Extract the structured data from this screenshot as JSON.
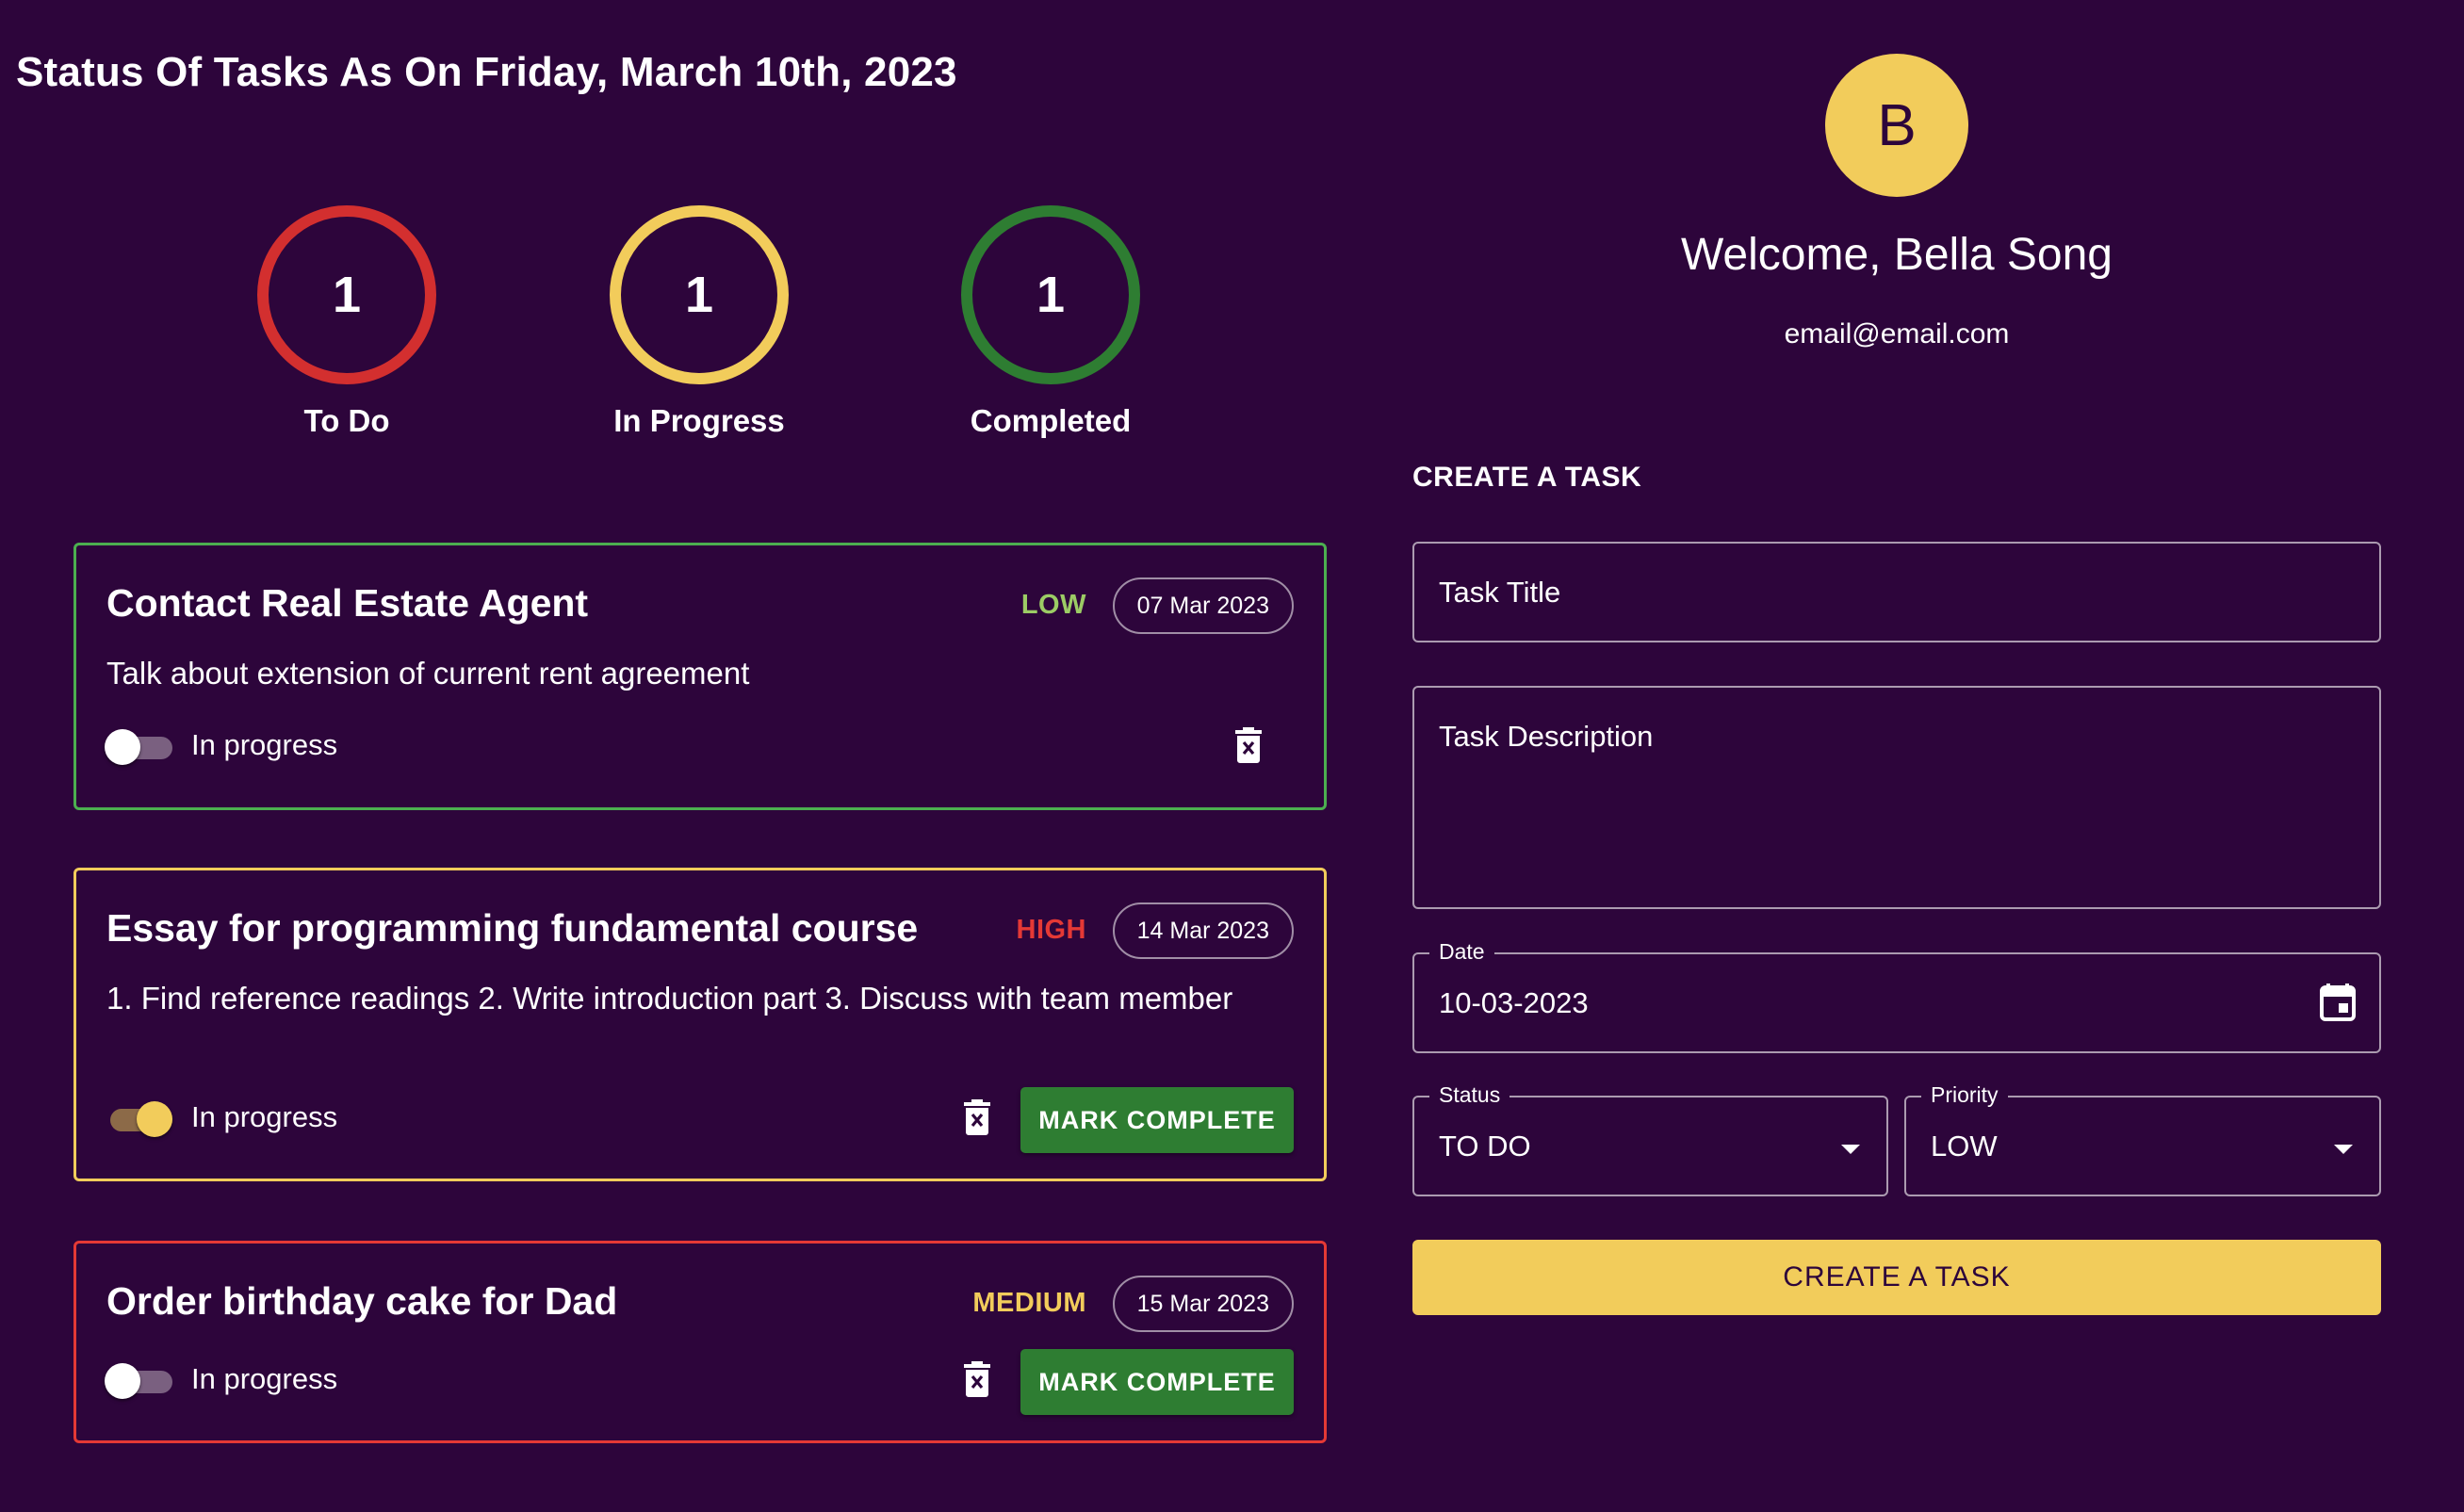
{
  "header": {
    "title": "Status Of Tasks As On Friday, March 10th, 2023"
  },
  "stats": [
    {
      "count": "1",
      "label": "To Do",
      "color": "#d32f2f"
    },
    {
      "count": "1",
      "label": "In Progress",
      "color": "#f2cc5b"
    },
    {
      "count": "1",
      "label": "Completed",
      "color": "#2e7d32"
    }
  ],
  "tasks": [
    {
      "title": "Contact Real Estate Agent",
      "description": "Talk about extension of current rent agreement",
      "priority": "LOW",
      "priority_color": "#9ccc65",
      "date": "07 Mar 2023",
      "toggle_label": "In progress",
      "toggle_on": false,
      "border_color": "#4caf50",
      "has_mark_complete": false
    },
    {
      "title": "Essay for programming fundamental course",
      "description": "1. Find reference readings 2. Write introduction part 3. Discuss with team member",
      "priority": "HIGH",
      "priority_color": "#e53935",
      "date": "14 Mar 2023",
      "toggle_label": "In progress",
      "toggle_on": true,
      "border_color": "#f2cc5b",
      "has_mark_complete": true,
      "mark_complete_label": "MARK COMPLETE"
    },
    {
      "title": "Order birthday cake for Dad",
      "description": "",
      "priority": "MEDIUM",
      "priority_color": "#f2cc5b",
      "date": "15 Mar 2023",
      "toggle_label": "In progress",
      "toggle_on": false,
      "border_color": "#e53935",
      "has_mark_complete": true,
      "mark_complete_label": "MARK COMPLETE"
    }
  ],
  "profile": {
    "initial": "B",
    "welcome": "Welcome, Bella Song",
    "email": "email@email.com"
  },
  "form": {
    "section_title": "CREATE A TASK",
    "title_placeholder": "Task Title",
    "description_placeholder": "Task Description",
    "date_label": "Date",
    "date_value": "10-03-2023",
    "status_label": "Status",
    "status_value": "TO DO",
    "priority_label": "Priority",
    "priority_value": "LOW",
    "submit_label": "CREATE A TASK"
  },
  "icons": {
    "card_delete": "trash-icon",
    "calendar": "calendar-icon",
    "dropdown": "chevron-down-icon"
  }
}
